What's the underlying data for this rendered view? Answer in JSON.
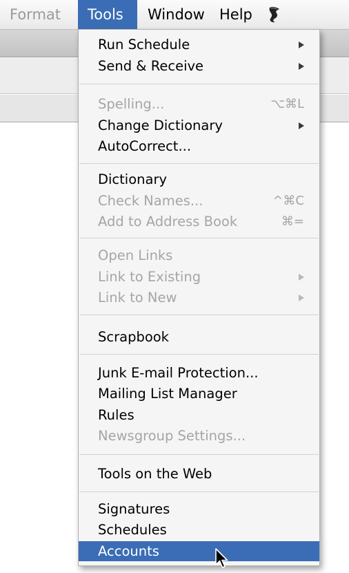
{
  "menubar": {
    "items": [
      {
        "label": "Format"
      },
      {
        "label": "Tools"
      },
      {
        "label": "Window"
      },
      {
        "label": "Help"
      }
    ],
    "script_icon": "applescript-scroll-icon"
  },
  "menu": {
    "items": [
      {
        "label": "Run Schedule",
        "submenu": true
      },
      {
        "label": "Send & Receive",
        "submenu": true
      },
      {
        "label": "Spelling...",
        "shortcut": "⌥⌘L",
        "disabled": true
      },
      {
        "label": "Change Dictionary",
        "submenu": true
      },
      {
        "label": "AutoCorrect..."
      },
      {
        "label": "Dictionary"
      },
      {
        "label": "Check Names...",
        "shortcut": "^⌘C",
        "disabled": true
      },
      {
        "label": "Add to Address Book",
        "shortcut": "⌘=",
        "disabled": true
      },
      {
        "label": "Open Links",
        "disabled": true
      },
      {
        "label": "Link to Existing",
        "submenu": true,
        "disabled": true
      },
      {
        "label": "Link to New",
        "submenu": true,
        "disabled": true
      },
      {
        "label": "Scrapbook"
      },
      {
        "label": "Junk E-mail Protection..."
      },
      {
        "label": "Mailing List Manager"
      },
      {
        "label": "Rules"
      },
      {
        "label": "Newsgroup Settings...",
        "disabled": true
      },
      {
        "label": "Tools on the Web"
      },
      {
        "label": "Signatures"
      },
      {
        "label": "Schedules"
      },
      {
        "label": "Accounts",
        "selected": true
      }
    ]
  },
  "colors": {
    "highlight": "#3a6db5",
    "menu_bg": "#f5f5f5",
    "disabled_text": "#a5a5a5"
  }
}
